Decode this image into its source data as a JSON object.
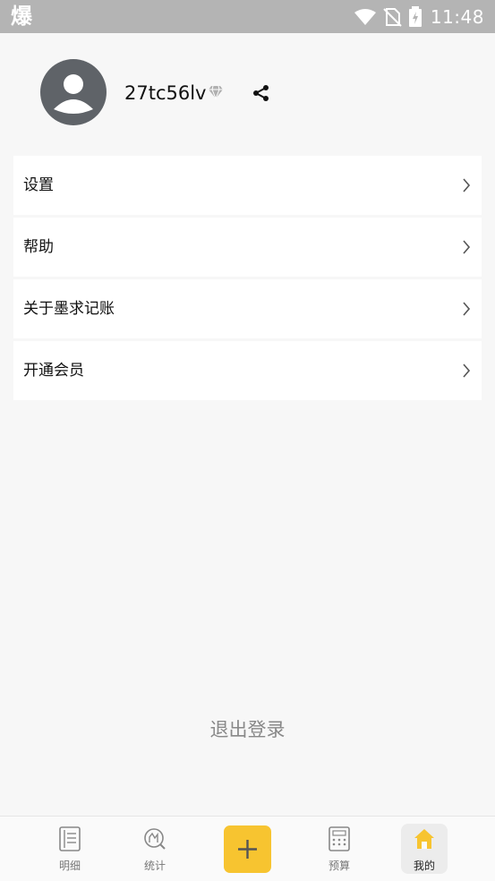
{
  "status_bar": {
    "app_icon_glyph": "爆",
    "time": "11:48"
  },
  "profile": {
    "username": "27tc56lv"
  },
  "menu": {
    "items": [
      {
        "label": "设置"
      },
      {
        "label": "帮助"
      },
      {
        "label": "关于墨求记账"
      },
      {
        "label": "开通会员"
      }
    ]
  },
  "logout_label": "退出登录",
  "bottom_nav": {
    "tabs": [
      {
        "label": "明细",
        "icon": "list-icon"
      },
      {
        "label": "统计",
        "icon": "statistics-icon"
      },
      {
        "label": "",
        "icon": "plus-icon"
      },
      {
        "label": "预算",
        "icon": "calculator-icon"
      },
      {
        "label": "我的",
        "icon": "home-icon"
      }
    ],
    "active_tab": "我的"
  },
  "colors": {
    "status_bar": "#b4b4b4",
    "accent": "#f7c430",
    "background": "#f7f7f7"
  }
}
